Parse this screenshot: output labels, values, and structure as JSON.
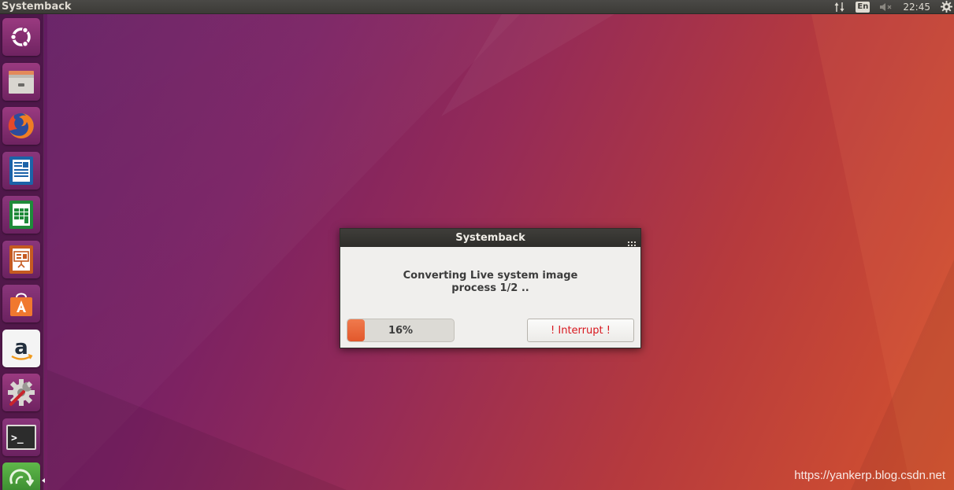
{
  "top_panel": {
    "app_title": "Systemback",
    "indicators": {
      "network_icon": "network-up-down-icon",
      "keyboard_layout": "En",
      "sound_icon": "sound-muted-icon",
      "sound_glyph": "🔈✕",
      "clock": "22:45",
      "system_icon": "gear-icon"
    }
  },
  "launcher": {
    "items": [
      {
        "name": "ubuntu-dash",
        "icon": "ubuntu-logo-icon"
      },
      {
        "name": "files",
        "icon": "file-cabinet-icon"
      },
      {
        "name": "firefox",
        "icon": "firefox-icon"
      },
      {
        "name": "libreoffice-writer",
        "icon": "document-writer-icon"
      },
      {
        "name": "libreoffice-calc",
        "icon": "spreadsheet-icon"
      },
      {
        "name": "libreoffice-impress",
        "icon": "presentation-icon"
      },
      {
        "name": "ubuntu-software",
        "icon": "shopping-bag-icon"
      },
      {
        "name": "amazon",
        "icon": "amazon-icon"
      },
      {
        "name": "system-settings",
        "icon": "settings-wrench-icon"
      },
      {
        "name": "terminal",
        "icon": "terminal-icon"
      },
      {
        "name": "systemback",
        "icon": "systemback-icon"
      }
    ],
    "terminal_prompt": ">_",
    "amazon_letter": "a"
  },
  "dialog": {
    "title": "Systemback",
    "message_line1": "Converting Live system image",
    "message_line2": "process 1/2 ..",
    "progress_percent": 16,
    "progress_label": "16%",
    "interrupt_label": "! Interrupt !"
  },
  "watermark": "https://yankerp.blog.csdn.net",
  "colors": {
    "progress_fill": "#e95f30",
    "interrupt_text": "#d8171e",
    "panel_bg": "#3c3b37"
  }
}
